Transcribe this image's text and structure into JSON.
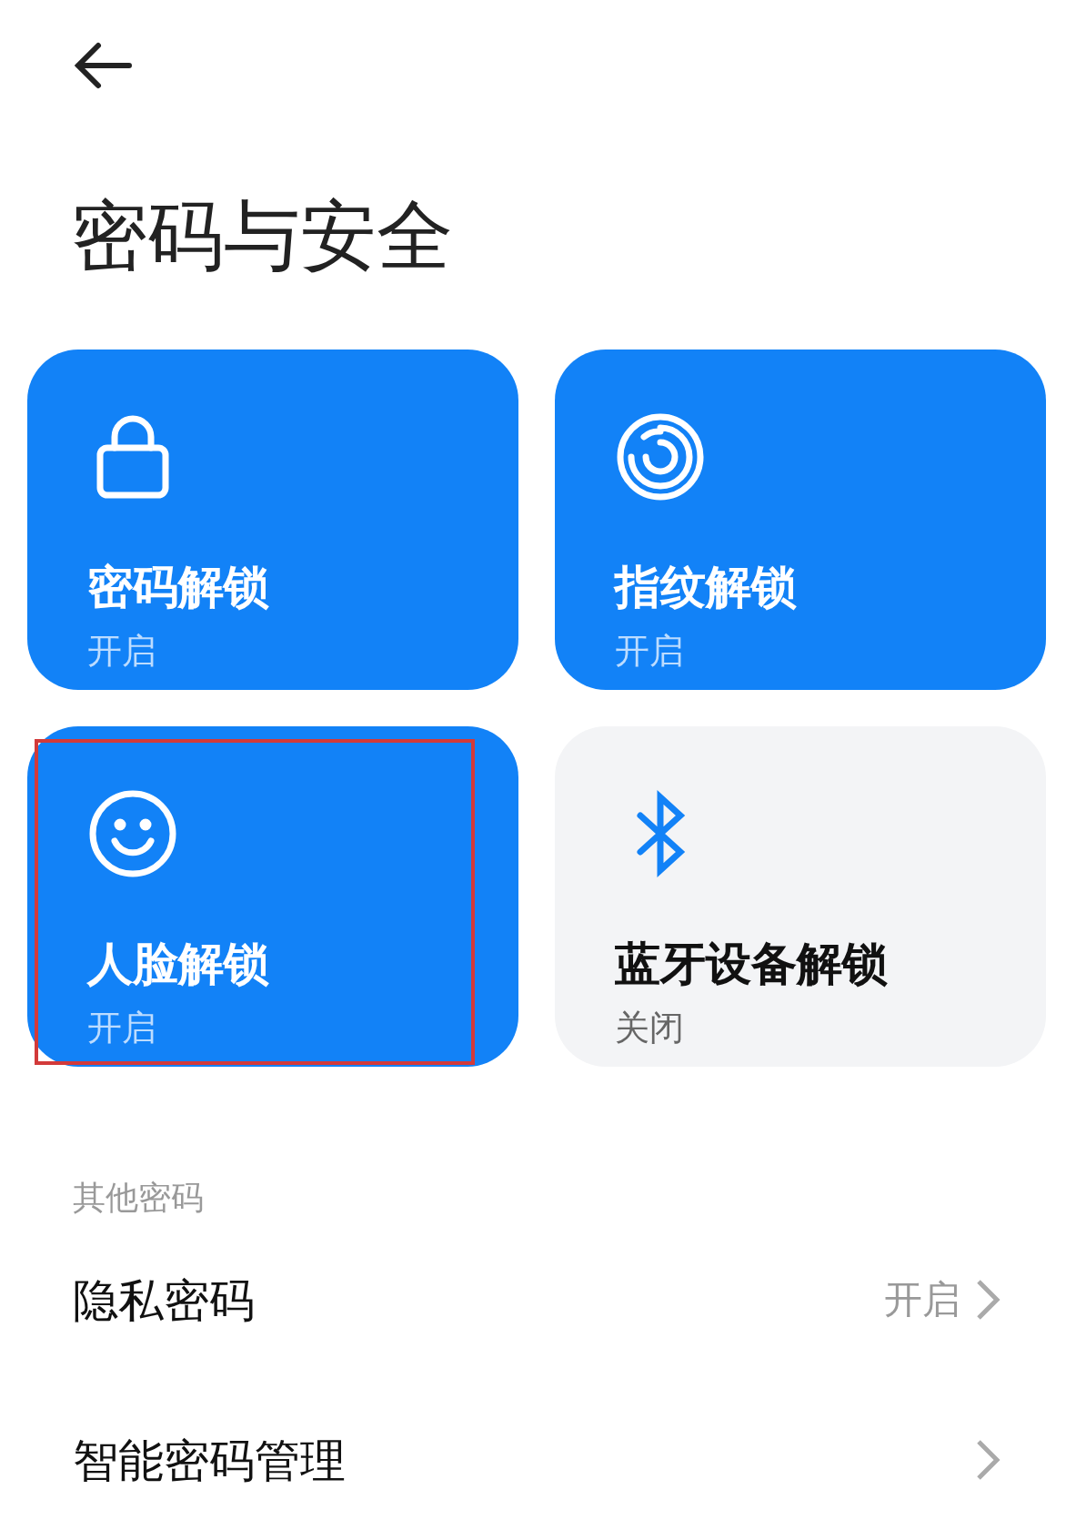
{
  "title": "密码与安全",
  "tiles": [
    {
      "kind": "lock",
      "label": "密码解锁",
      "status": "开启",
      "on": true,
      "highlighted": false
    },
    {
      "kind": "fingerprint",
      "label": "指纹解锁",
      "status": "开启",
      "on": true,
      "highlighted": false
    },
    {
      "kind": "face",
      "label": "人脸解锁",
      "status": "开启",
      "on": true,
      "highlighted": true
    },
    {
      "kind": "bluetooth",
      "label": "蓝牙设备解锁",
      "status": "关闭",
      "on": false,
      "highlighted": false
    }
  ],
  "section": {
    "label": "其他密码",
    "rows": [
      {
        "label": "隐私密码",
        "value": "开启"
      },
      {
        "label": "智能密码管理"
      }
    ]
  }
}
